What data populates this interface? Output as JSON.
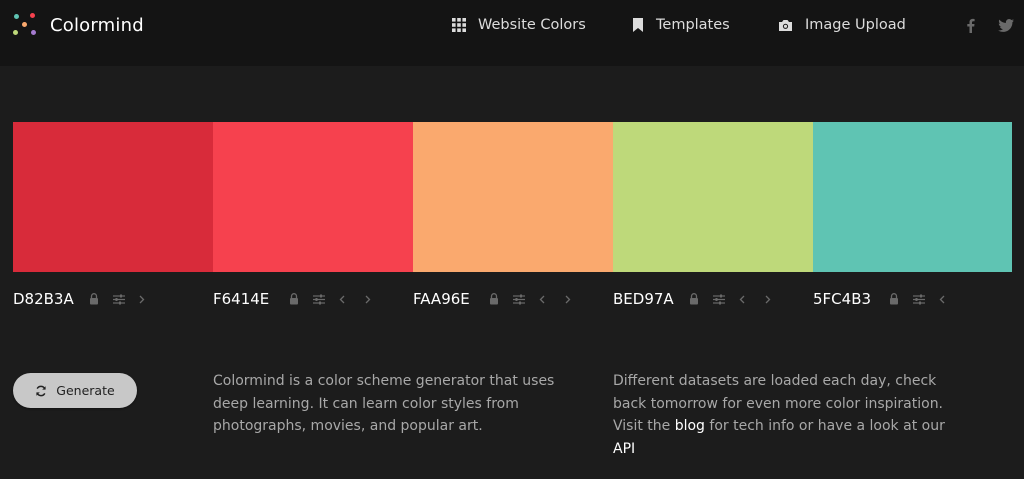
{
  "app": {
    "brand": "Colormind",
    "logo_dot_colors": [
      "#5FC4B3",
      "#F6414E",
      "#FAA96E",
      "#BED97A",
      "#A57BD0",
      "#4EA3E0"
    ]
  },
  "nav": {
    "links": [
      {
        "label": "Website Colors",
        "icon": "grid-icon"
      },
      {
        "label": "Templates",
        "icon": "bookmark-icon"
      },
      {
        "label": "Image Upload",
        "icon": "camera-icon"
      }
    ],
    "social": [
      "facebook-icon",
      "twitter-icon"
    ]
  },
  "palette": {
    "colors": [
      {
        "hex": "D82B3A",
        "swatch": "#D82B3A"
      },
      {
        "hex": "F6414E",
        "swatch": "#F6414E"
      },
      {
        "hex": "FAA96E",
        "swatch": "#FAA96E"
      },
      {
        "hex": "BED97A",
        "swatch": "#BED97A"
      },
      {
        "hex": "5FC4B3",
        "swatch": "#5FC4B3"
      }
    ]
  },
  "actions": {
    "generate_label": "Generate"
  },
  "descriptions": {
    "left": "Colormind is a color scheme generator that uses deep learning. It can learn color styles from photographs, movies, and popular art.",
    "right_prefix": "Different datasets are loaded each day, check back tomorrow for even more color inspiration. Visit the ",
    "right_link_blog": "blog",
    "right_middle": " for tech info or have a look at our ",
    "right_link_api": "API"
  },
  "theme": {
    "background": "#1c1c1c",
    "navbar": "#141414",
    "icon_muted": "#6a6a6a"
  }
}
